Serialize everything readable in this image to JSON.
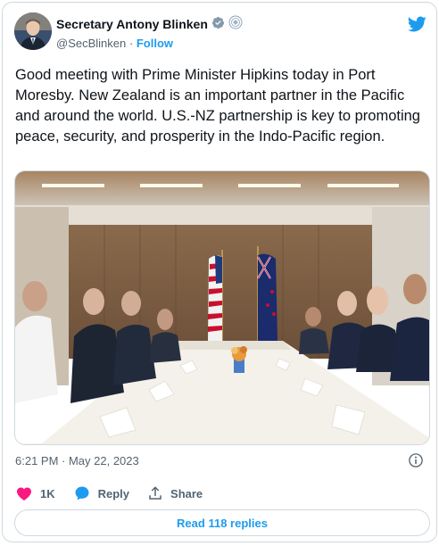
{
  "author": {
    "name": "Secretary Antony Blinken",
    "handle": "@SecBlinken",
    "separator": "·",
    "follow_label": "Follow"
  },
  "tweet": {
    "text": "Good meeting with Prime Minister Hipkins today in Port Moresby. New Zealand is an important partner in the Pacific and around the world.  U.S.-NZ partnership is key to promoting peace, security, and prosperity in the Indo-Pacific region.",
    "timestamp": "6:21 PM · May 22, 2023"
  },
  "actions": {
    "likes": "1K",
    "reply_label": "Reply",
    "share_label": "Share"
  },
  "read_replies_label": "Read 118 replies",
  "colors": {
    "accent": "#1d9bf0",
    "like": "#f91880",
    "muted": "#536471",
    "verified": "#829aab"
  }
}
